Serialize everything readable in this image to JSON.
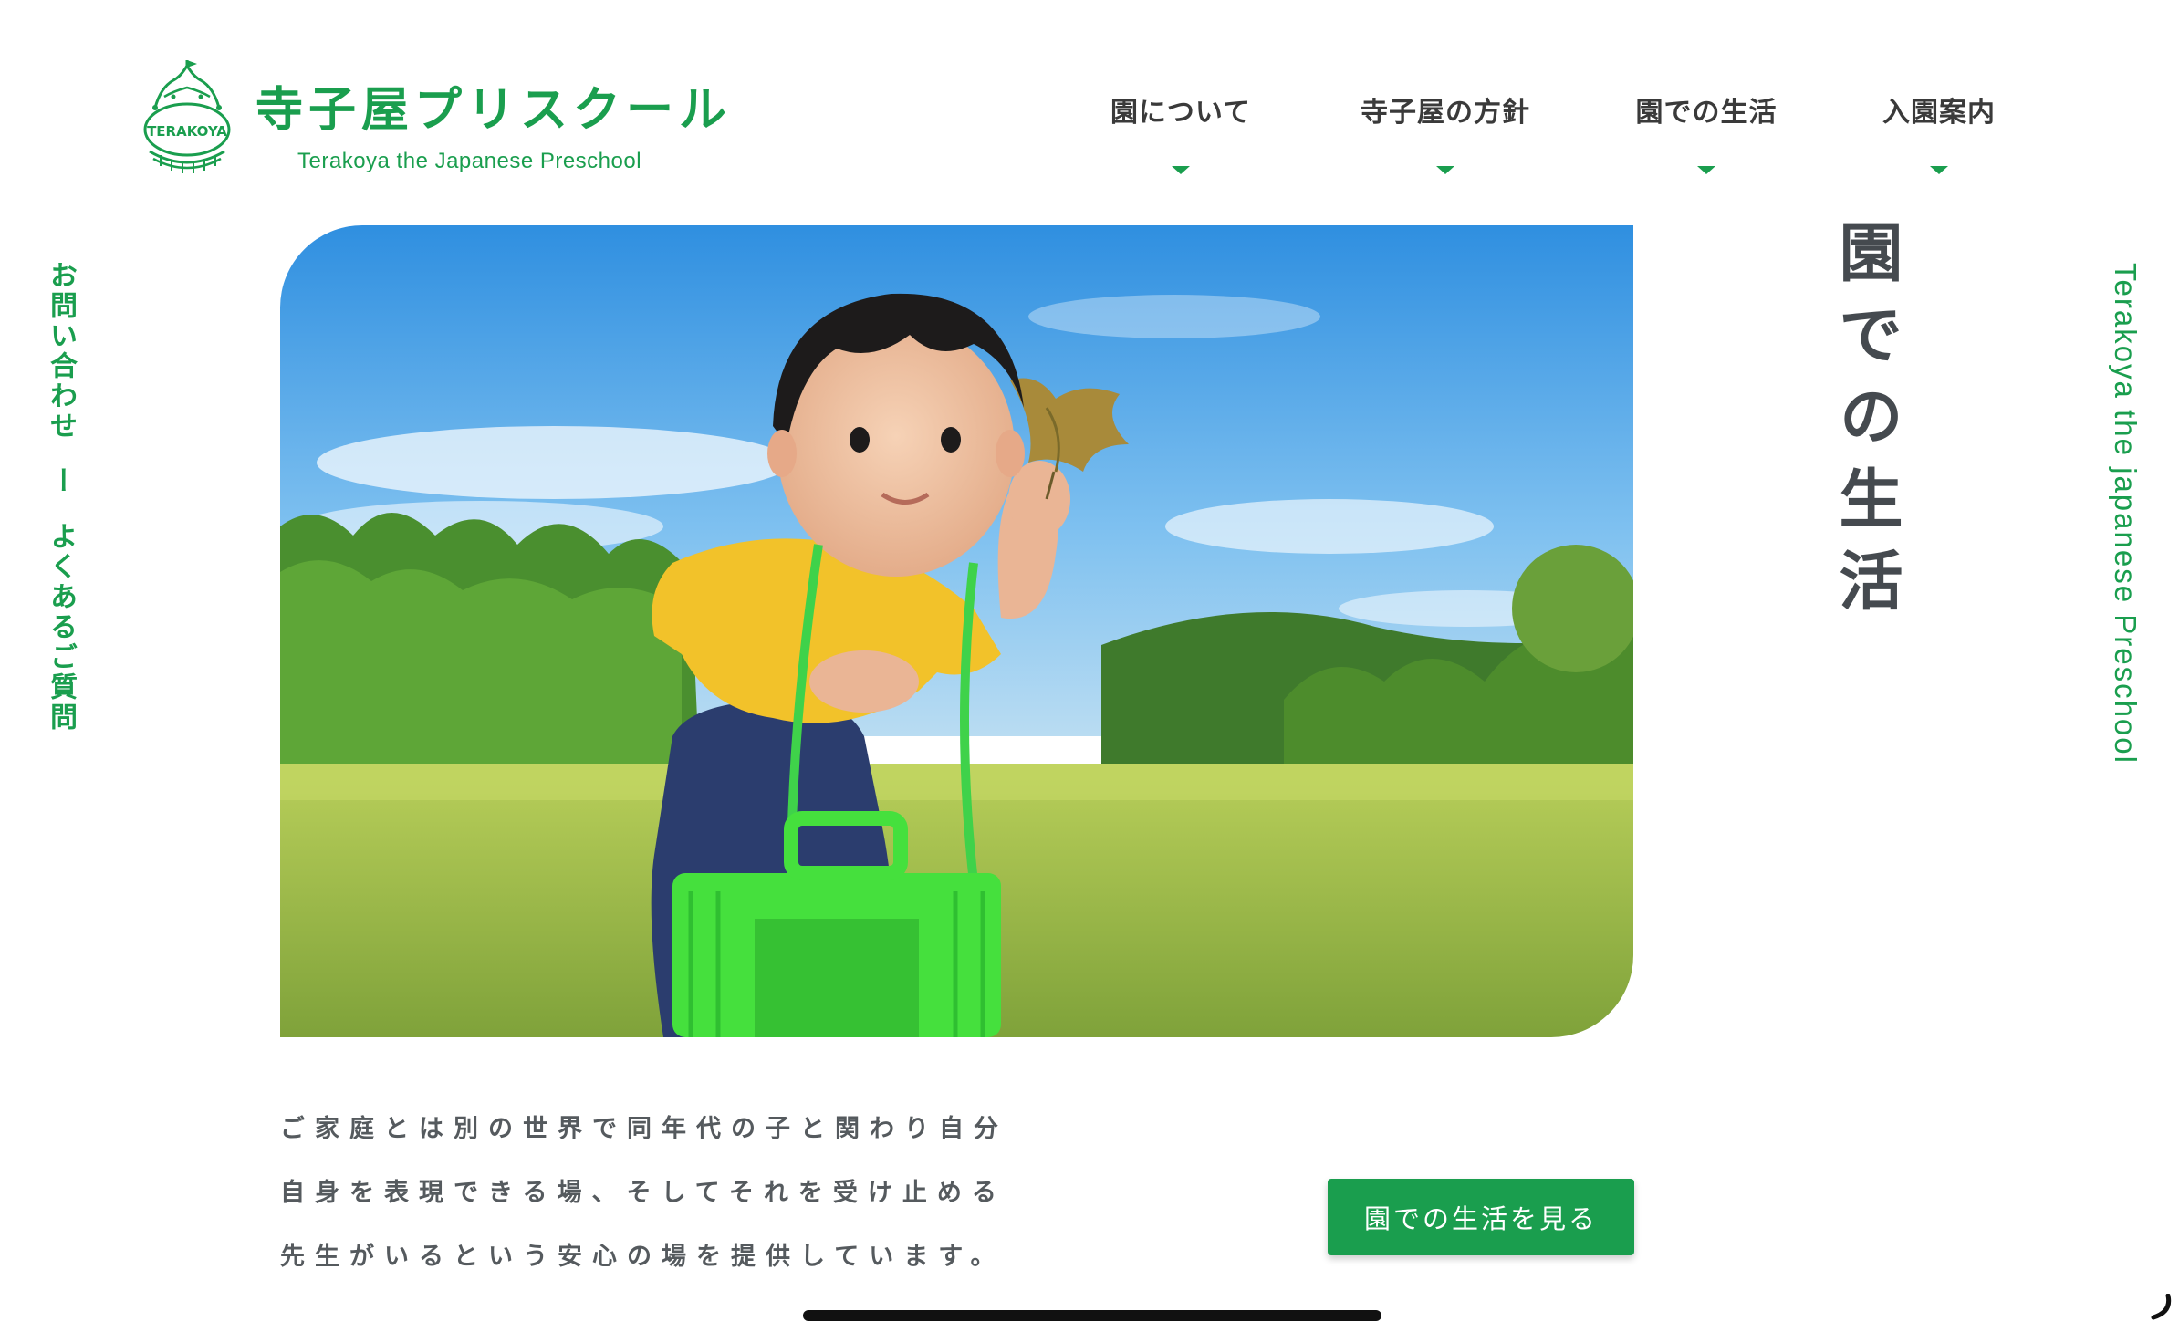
{
  "logo": {
    "title": "寺子屋プリスクール",
    "subtitle": "Terakoya the Japanese Preschool",
    "emblem_text": "TERAKOYA"
  },
  "nav": {
    "items": [
      {
        "label": "園について"
      },
      {
        "label": "寺子屋の方針"
      },
      {
        "label": "園での生活"
      },
      {
        "label": "入園案内"
      }
    ]
  },
  "side_links": {
    "contact": "お問い合わせ",
    "separator": "ー",
    "faq": "よくあるご質問"
  },
  "side_english": "Terakoya the japanese Preschool",
  "section": {
    "heading": "園での生活",
    "description": [
      "ご家庭とは別の世界で同年代の子と関わり自分",
      "自身を表現できる場、そしてそれを受け止める",
      "先生がいるという安心の場を提供しています。"
    ],
    "cta_label": "園での生活を見る"
  },
  "hero": {
    "subject": "child-holding-leaf-in-park"
  },
  "colors": {
    "brand_green": "#1a9e4e",
    "heading_gray": "#454a4f",
    "text_gray": "#555a5e",
    "nav_text": "#3a3a3a"
  }
}
